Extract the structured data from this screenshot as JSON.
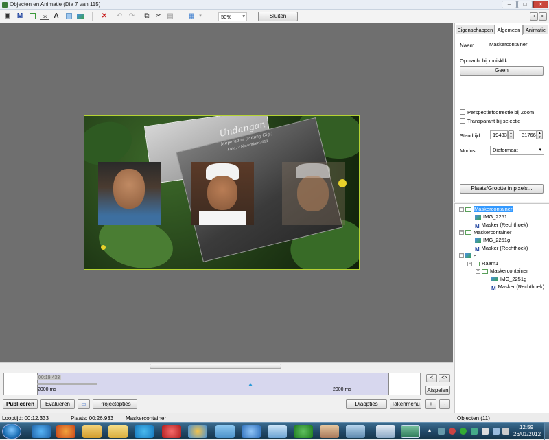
{
  "window": {
    "title": "Objecten en Animatie  (Dia 7 van 115)"
  },
  "toolbar": {
    "zoom_value": "50%",
    "close_label": "Sluiten",
    "icons": [
      "camera-icon",
      "mask-m-icon",
      "rectangle-icon",
      "text-box-icon",
      "text-a-icon",
      "fill-icon",
      "image-icon",
      "delete-icon",
      "undo-icon",
      "redo-icon",
      "copy-icon",
      "cut-icon",
      "paste-icon",
      "grid-icon"
    ]
  },
  "right_panel": {
    "tabs": [
      {
        "label": "Eigenschappen"
      },
      {
        "label": "Algemeen"
      },
      {
        "label": "Animatie"
      }
    ],
    "name_label": "Naam",
    "name_value": "Maskercontainer",
    "click_action_label": "Opdracht bij muisklik",
    "click_action_button": "Geen",
    "perspective_label": "Perspectiefcorrectie bij Zoom",
    "transparent_label": "Transparant bij selectie",
    "duration_label": "Standtijd",
    "duration_start": "19433",
    "duration_end": "31766",
    "mode_label": "Modus",
    "mode_value": "Diaformaat",
    "place_size_button": "Plaats/Grootte in pixels..."
  },
  "tree": {
    "items": [
      {
        "label": "Maskercontainer",
        "level": 0,
        "icon": "mask-container-icon",
        "selected": true,
        "expander": "−"
      },
      {
        "label": "IMG_2251",
        "level": 1,
        "icon": "image-icon"
      },
      {
        "label": "Masker (Rechthoek)",
        "level": 1,
        "icon": "mask-m-icon"
      },
      {
        "label": "Maskercontainer",
        "level": 0,
        "icon": "mask-container-icon",
        "expander": "−"
      },
      {
        "label": "IMG_2251g",
        "level": 1,
        "icon": "image-icon"
      },
      {
        "label": "Masker (Rechthoek)",
        "level": 1,
        "icon": "mask-m-icon"
      },
      {
        "label": "e",
        "level": 0,
        "icon": "image-icon",
        "expander": "−"
      },
      {
        "label": "Raam1",
        "level": 1,
        "icon": "mask-container-icon",
        "expander": "−"
      },
      {
        "label": "Maskercontainer",
        "level": 2,
        "icon": "mask-container-icon",
        "expander": "−"
      },
      {
        "label": "IMG_2251g",
        "level": 3,
        "icon": "image-icon"
      },
      {
        "label": "Masker (Rechthoek)",
        "level": 3,
        "icon": "mask-m-icon"
      }
    ]
  },
  "timeline": {
    "start_time": "00:19.433",
    "left_duration": "2000 ms",
    "right_duration": "2000 ms",
    "zoom_minus": "<",
    "zoom_plus": "<>",
    "play_label": "Afspelen"
  },
  "bottom": {
    "publish_label": "Publiceren",
    "evaluate_label": "Evalueren",
    "project_options_label": "Projectopties",
    "slide_options_label": "Diaopties",
    "task_menu_label": "Takenmenu",
    "plus_label": "+",
    "minus_label": "-"
  },
  "status": {
    "runtime": "Looptijd:  00:12.333",
    "position": "Plaats:  00:26.933",
    "object_name": "Maskercontainer",
    "objects_count": "Objecten (11)"
  },
  "taskbar": {
    "time": "12:59",
    "date": "26/01/2012"
  },
  "photo": {
    "card_title": "Undangan",
    "card_names": "Meperadan (Potong Gigi)",
    "card_date": "Kuta, 7 November 2011"
  },
  "colors": {
    "selection": "#3399ff",
    "canvas_bg": "#6f6f6f",
    "slide_border": "#b5d334"
  }
}
